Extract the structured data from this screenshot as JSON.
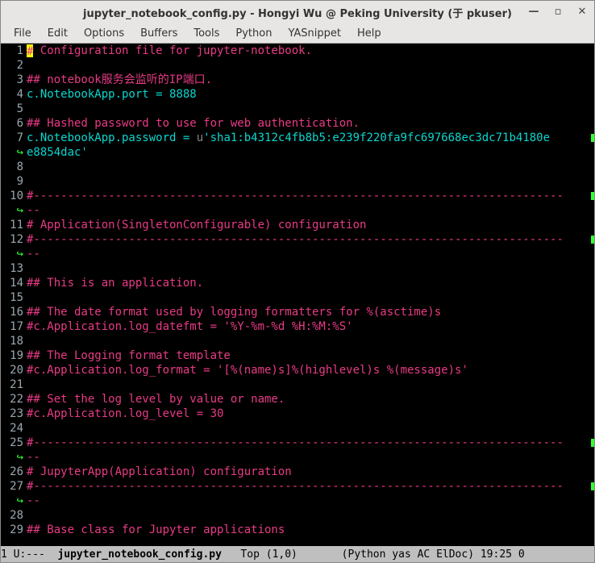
{
  "title": "jupyter_notebook_config.py - Hongyi Wu @ Peking University (于  pkuser)",
  "menus": [
    "File",
    "Edit",
    "Options",
    "Buffers",
    "Tools",
    "Python",
    "YASnippet",
    "Help"
  ],
  "modeline": {
    "left": "1 U:---  ",
    "buffer": "jupyter_notebook_config.py",
    "mid": "   Top (1,0)       ",
    "right": "(Python yas AC ElDoc) 19:25 0"
  },
  "lines": {
    "l1": "# Configuration file for jupyter-notebook.",
    "l3": "## notebook服务会监听的IP端口.",
    "l4a": "c.NotebookApp.port ",
    "l4b": "= ",
    "l4c": "8888",
    "l6": "## Hashed password to use for web authentication.",
    "l7a": "c.NotebookApp.password ",
    "l7b": "= ",
    "l7c": "u",
    "l7d": "'sha1:b4312c4fb8b5:e239f220fa9fc697668ec3dc71b4180e",
    "l7e": "e8854dac'",
    "l10a": "#------------------------------------------------------------------------------",
    "l10b": "--",
    "l11": "# Application(SingletonConfigurable) configuration",
    "l12a": "#------------------------------------------------------------------------------",
    "l12b": "--",
    "l14": "## This is an application.",
    "l16": "## The date format used by logging formatters for %(asctime)s",
    "l17": "#c.Application.log_datefmt = '%Y-%m-%d %H:%M:%S'",
    "l19": "## The Logging format template",
    "l20": "#c.Application.log_format = '[%(name)s]%(highlevel)s %(message)s'",
    "l22": "## Set the log level by value or name.",
    "l23": "#c.Application.log_level = 30",
    "l25a": "#------------------------------------------------------------------------------",
    "l25b": "--",
    "l26": "# JupyterApp(Application) configuration",
    "l27a": "#------------------------------------------------------------------------------",
    "l27b": "--",
    "l29": "## Base class for Jupyter applications"
  }
}
